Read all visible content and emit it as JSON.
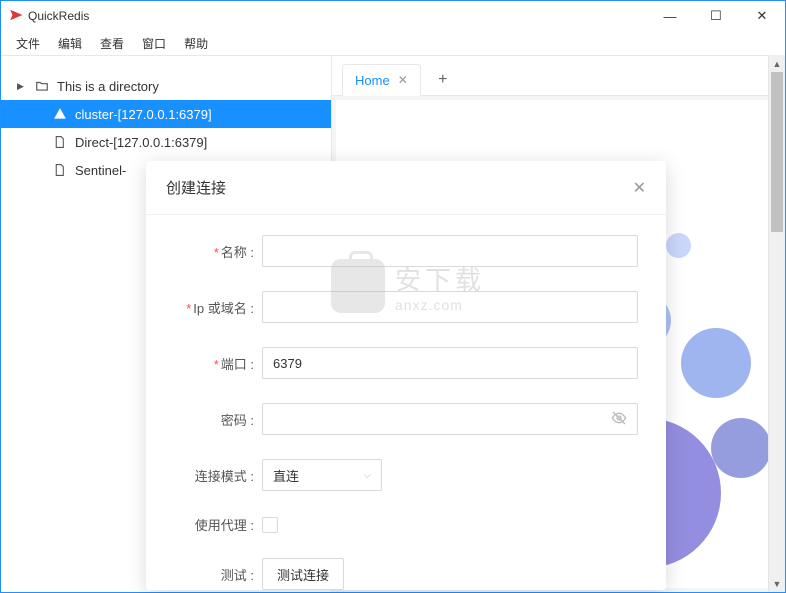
{
  "titlebar": {
    "title": "QuickRedis"
  },
  "menubar": {
    "items": [
      "文件",
      "编辑",
      "查看",
      "窗口",
      "帮助"
    ]
  },
  "sidebar": {
    "items": [
      {
        "label": "This is a directory",
        "type": "dir"
      },
      {
        "label": "cluster-[127.0.0.1:6379]",
        "type": "cluster",
        "selected": true
      },
      {
        "label": "Direct-[127.0.0.1:6379]",
        "type": "file"
      },
      {
        "label": "Sentinel-",
        "type": "file"
      }
    ]
  },
  "tabs": {
    "items": [
      {
        "label": "Home"
      }
    ]
  },
  "modal": {
    "title": "创建连接",
    "fields": {
      "name_label": "名称",
      "host_label": "Ip 或域名",
      "port_label": "端口",
      "port_value": "6379",
      "password_label": "密码",
      "mode_label": "连接模式",
      "mode_value": "直连",
      "proxy_label": "使用代理",
      "test_label": "测试",
      "test_button": "测试连接"
    }
  },
  "watermark": {
    "zh": "安下载",
    "en": "anxz.com"
  }
}
